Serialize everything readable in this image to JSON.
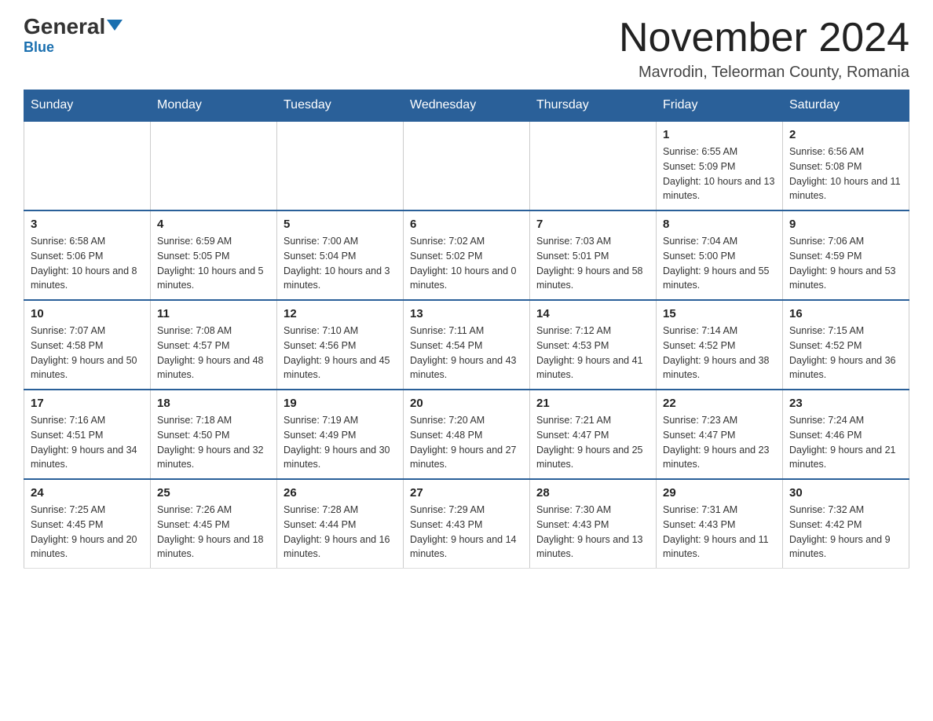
{
  "header": {
    "logo_general": "General",
    "logo_blue": "Blue",
    "month_title": "November 2024",
    "location": "Mavrodin, Teleorman County, Romania"
  },
  "weekdays": [
    "Sunday",
    "Monday",
    "Tuesday",
    "Wednesday",
    "Thursday",
    "Friday",
    "Saturday"
  ],
  "weeks": [
    [
      {
        "day": "",
        "sunrise": "",
        "sunset": "",
        "daylight": ""
      },
      {
        "day": "",
        "sunrise": "",
        "sunset": "",
        "daylight": ""
      },
      {
        "day": "",
        "sunrise": "",
        "sunset": "",
        "daylight": ""
      },
      {
        "day": "",
        "sunrise": "",
        "sunset": "",
        "daylight": ""
      },
      {
        "day": "",
        "sunrise": "",
        "sunset": "",
        "daylight": ""
      },
      {
        "day": "1",
        "sunrise": "Sunrise: 6:55 AM",
        "sunset": "Sunset: 5:09 PM",
        "daylight": "Daylight: 10 hours and 13 minutes."
      },
      {
        "day": "2",
        "sunrise": "Sunrise: 6:56 AM",
        "sunset": "Sunset: 5:08 PM",
        "daylight": "Daylight: 10 hours and 11 minutes."
      }
    ],
    [
      {
        "day": "3",
        "sunrise": "Sunrise: 6:58 AM",
        "sunset": "Sunset: 5:06 PM",
        "daylight": "Daylight: 10 hours and 8 minutes."
      },
      {
        "day": "4",
        "sunrise": "Sunrise: 6:59 AM",
        "sunset": "Sunset: 5:05 PM",
        "daylight": "Daylight: 10 hours and 5 minutes."
      },
      {
        "day": "5",
        "sunrise": "Sunrise: 7:00 AM",
        "sunset": "Sunset: 5:04 PM",
        "daylight": "Daylight: 10 hours and 3 minutes."
      },
      {
        "day": "6",
        "sunrise": "Sunrise: 7:02 AM",
        "sunset": "Sunset: 5:02 PM",
        "daylight": "Daylight: 10 hours and 0 minutes."
      },
      {
        "day": "7",
        "sunrise": "Sunrise: 7:03 AM",
        "sunset": "Sunset: 5:01 PM",
        "daylight": "Daylight: 9 hours and 58 minutes."
      },
      {
        "day": "8",
        "sunrise": "Sunrise: 7:04 AM",
        "sunset": "Sunset: 5:00 PM",
        "daylight": "Daylight: 9 hours and 55 minutes."
      },
      {
        "day": "9",
        "sunrise": "Sunrise: 7:06 AM",
        "sunset": "Sunset: 4:59 PM",
        "daylight": "Daylight: 9 hours and 53 minutes."
      }
    ],
    [
      {
        "day": "10",
        "sunrise": "Sunrise: 7:07 AM",
        "sunset": "Sunset: 4:58 PM",
        "daylight": "Daylight: 9 hours and 50 minutes."
      },
      {
        "day": "11",
        "sunrise": "Sunrise: 7:08 AM",
        "sunset": "Sunset: 4:57 PM",
        "daylight": "Daylight: 9 hours and 48 minutes."
      },
      {
        "day": "12",
        "sunrise": "Sunrise: 7:10 AM",
        "sunset": "Sunset: 4:56 PM",
        "daylight": "Daylight: 9 hours and 45 minutes."
      },
      {
        "day": "13",
        "sunrise": "Sunrise: 7:11 AM",
        "sunset": "Sunset: 4:54 PM",
        "daylight": "Daylight: 9 hours and 43 minutes."
      },
      {
        "day": "14",
        "sunrise": "Sunrise: 7:12 AM",
        "sunset": "Sunset: 4:53 PM",
        "daylight": "Daylight: 9 hours and 41 minutes."
      },
      {
        "day": "15",
        "sunrise": "Sunrise: 7:14 AM",
        "sunset": "Sunset: 4:52 PM",
        "daylight": "Daylight: 9 hours and 38 minutes."
      },
      {
        "day": "16",
        "sunrise": "Sunrise: 7:15 AM",
        "sunset": "Sunset: 4:52 PM",
        "daylight": "Daylight: 9 hours and 36 minutes."
      }
    ],
    [
      {
        "day": "17",
        "sunrise": "Sunrise: 7:16 AM",
        "sunset": "Sunset: 4:51 PM",
        "daylight": "Daylight: 9 hours and 34 minutes."
      },
      {
        "day": "18",
        "sunrise": "Sunrise: 7:18 AM",
        "sunset": "Sunset: 4:50 PM",
        "daylight": "Daylight: 9 hours and 32 minutes."
      },
      {
        "day": "19",
        "sunrise": "Sunrise: 7:19 AM",
        "sunset": "Sunset: 4:49 PM",
        "daylight": "Daylight: 9 hours and 30 minutes."
      },
      {
        "day": "20",
        "sunrise": "Sunrise: 7:20 AM",
        "sunset": "Sunset: 4:48 PM",
        "daylight": "Daylight: 9 hours and 27 minutes."
      },
      {
        "day": "21",
        "sunrise": "Sunrise: 7:21 AM",
        "sunset": "Sunset: 4:47 PM",
        "daylight": "Daylight: 9 hours and 25 minutes."
      },
      {
        "day": "22",
        "sunrise": "Sunrise: 7:23 AM",
        "sunset": "Sunset: 4:47 PM",
        "daylight": "Daylight: 9 hours and 23 minutes."
      },
      {
        "day": "23",
        "sunrise": "Sunrise: 7:24 AM",
        "sunset": "Sunset: 4:46 PM",
        "daylight": "Daylight: 9 hours and 21 minutes."
      }
    ],
    [
      {
        "day": "24",
        "sunrise": "Sunrise: 7:25 AM",
        "sunset": "Sunset: 4:45 PM",
        "daylight": "Daylight: 9 hours and 20 minutes."
      },
      {
        "day": "25",
        "sunrise": "Sunrise: 7:26 AM",
        "sunset": "Sunset: 4:45 PM",
        "daylight": "Daylight: 9 hours and 18 minutes."
      },
      {
        "day": "26",
        "sunrise": "Sunrise: 7:28 AM",
        "sunset": "Sunset: 4:44 PM",
        "daylight": "Daylight: 9 hours and 16 minutes."
      },
      {
        "day": "27",
        "sunrise": "Sunrise: 7:29 AM",
        "sunset": "Sunset: 4:43 PM",
        "daylight": "Daylight: 9 hours and 14 minutes."
      },
      {
        "day": "28",
        "sunrise": "Sunrise: 7:30 AM",
        "sunset": "Sunset: 4:43 PM",
        "daylight": "Daylight: 9 hours and 13 minutes."
      },
      {
        "day": "29",
        "sunrise": "Sunrise: 7:31 AM",
        "sunset": "Sunset: 4:43 PM",
        "daylight": "Daylight: 9 hours and 11 minutes."
      },
      {
        "day": "30",
        "sunrise": "Sunrise: 7:32 AM",
        "sunset": "Sunset: 4:42 PM",
        "daylight": "Daylight: 9 hours and 9 minutes."
      }
    ]
  ]
}
